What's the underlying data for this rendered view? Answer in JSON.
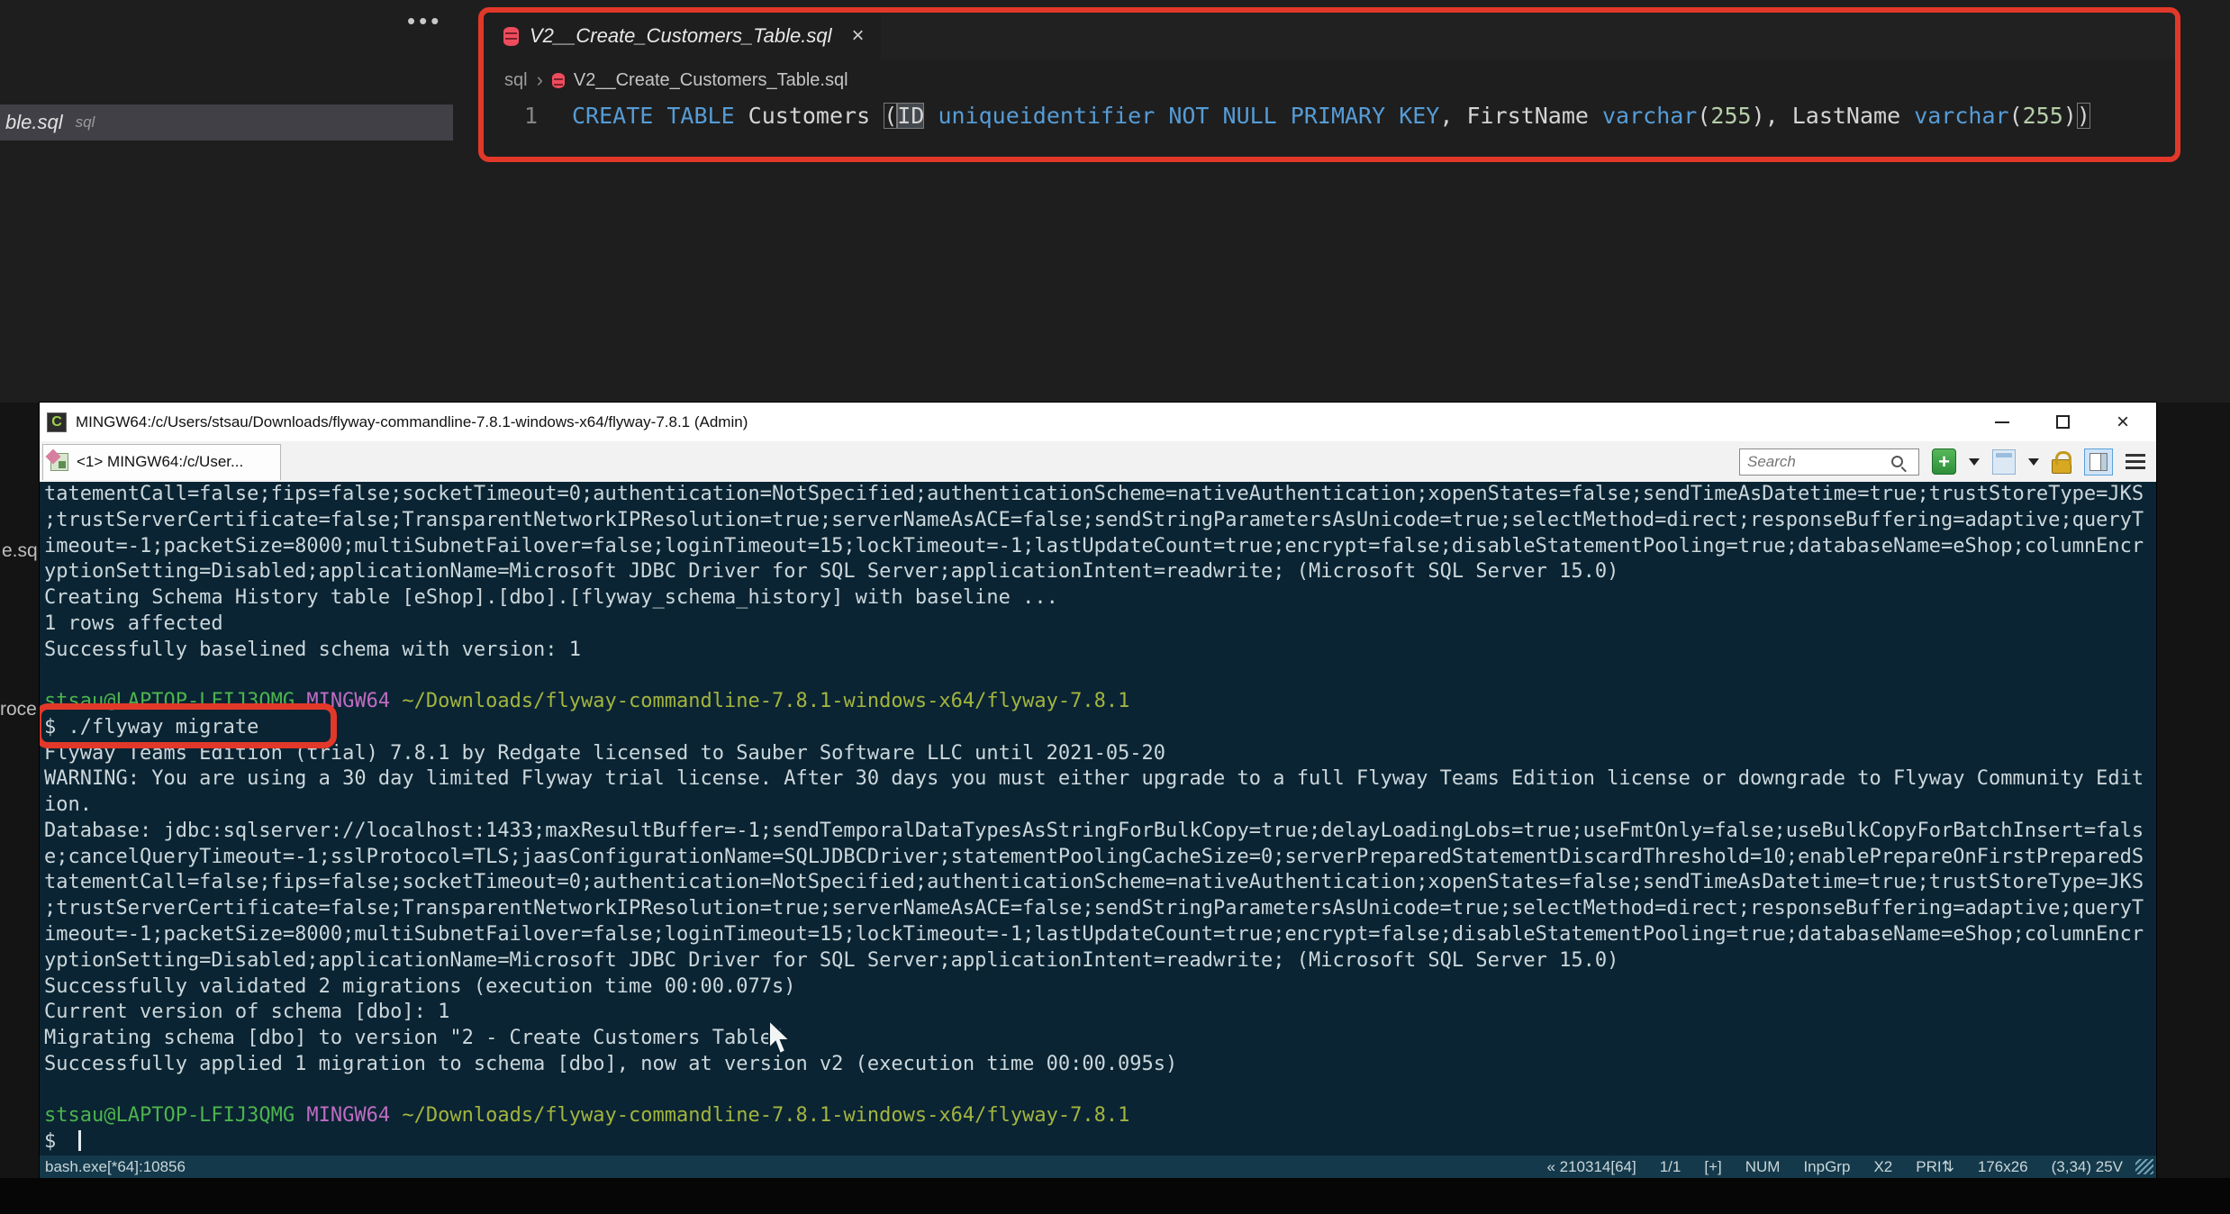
{
  "colors": {
    "annotation_red": "#e2382a",
    "terminal_bg": "#0a2433",
    "keyword_blue": "#569cd6",
    "number_green": "#b5cea8",
    "prompt_user_green": "#4db34d",
    "prompt_env_purple": "#bf6cc3",
    "prompt_path_olive": "#a3b43e"
  },
  "editor": {
    "more_actions_icon": "•••",
    "background_tab": {
      "filename": "ble.sql",
      "hint": "sql"
    },
    "fragments": {
      "one": "e.sq",
      "two": "roce"
    },
    "tab": {
      "filename": "V2__Create_Customers_Table.sql",
      "close_icon": "×"
    },
    "breadcrumb": {
      "folder": "sql",
      "separator": "›",
      "filename": "V2__Create_Customers_Table.sql"
    },
    "code": {
      "line_number": "1",
      "tokens": [
        {
          "text": "CREATE TABLE",
          "c": "kw"
        },
        {
          "text": " Customers ",
          "c": "pl"
        },
        {
          "text": "(",
          "c": "pl bracket"
        },
        {
          "text": "ID",
          "c": "pl word"
        },
        {
          "text": " ",
          "c": "pl"
        },
        {
          "text": "uniqueidentifier",
          "c": "kw"
        },
        {
          "text": " ",
          "c": "pl"
        },
        {
          "text": "NOT NULL PRIMARY KEY",
          "c": "kw"
        },
        {
          "text": ", FirstName ",
          "c": "pl"
        },
        {
          "text": "varchar",
          "c": "kw"
        },
        {
          "text": "(",
          "c": "pl"
        },
        {
          "text": "255",
          "c": "num"
        },
        {
          "text": ")",
          "c": "pl"
        },
        {
          "text": ", LastName ",
          "c": "pl"
        },
        {
          "text": "varchar",
          "c": "kw"
        },
        {
          "text": "(",
          "c": "pl"
        },
        {
          "text": "255",
          "c": "num"
        },
        {
          "text": ")",
          "c": "pl"
        },
        {
          "text": ")",
          "c": "pl bracket"
        }
      ]
    }
  },
  "terminal": {
    "title": "MINGW64:/c/Users/stsau/Downloads/flyway-commandline-7.8.1-windows-x64/flyway-7.8.1 (Admin)",
    "window_icon_letter": "C",
    "window_controls": {
      "close_icon": "×"
    },
    "tab_label": "<1> MINGW64:/c/User...",
    "search_placeholder": "Search",
    "new_console_label": "+",
    "prompt": {
      "user": "stsau@LAPTOP-LFIJ3QMG",
      "env": "MINGW64",
      "path": "~/Downloads/flyway-commandline-7.8.1-windows-x64/flyway-7.8.1"
    },
    "command": "$ ./flyway migrate",
    "input_prefix": "$ ",
    "lines": [
      {
        "t": "out",
        "text": "tatementCall=false;fips=false;socketTimeout=0;authentication=NotSpecified;authenticationScheme=nativeAuthentication;xopenStates=false;sendTimeAsDatetime=true;trustStoreType=JKS"
      },
      {
        "t": "out",
        "text": ";trustServerCertificate=false;TransparentNetworkIPResolution=true;serverNameAsACE=false;sendStringParametersAsUnicode=true;selectMethod=direct;responseBuffering=adaptive;queryT"
      },
      {
        "t": "out",
        "text": "imeout=-1;packetSize=8000;multiSubnetFailover=false;loginTimeout=15;lockTimeout=-1;lastUpdateCount=true;encrypt=false;disableStatementPooling=true;databaseName=eShop;columnEncr"
      },
      {
        "t": "out",
        "text": "yptionSetting=Disabled;applicationName=Microsoft JDBC Driver for SQL Server;applicationIntent=readwrite; (Microsoft SQL Server 15.0)"
      },
      {
        "t": "out",
        "text": "Creating Schema History table [eShop].[dbo].[flyway_schema_history] with baseline ..."
      },
      {
        "t": "out",
        "text": "1 rows affected"
      },
      {
        "t": "out",
        "text": "Successfully baselined schema with version: 1"
      },
      {
        "t": "blank"
      },
      {
        "t": "prompt"
      },
      {
        "t": "cmd"
      },
      {
        "t": "out",
        "text": "Flyway Teams Edition (trial) 7.8.1 by Redgate licensed to Sauber Software LLC until 2021-05-20"
      },
      {
        "t": "out",
        "text": "WARNING: You are using a 30 day limited Flyway trial license. After 30 days you must either upgrade to a full Flyway Teams Edition license or downgrade to Flyway Community Edit"
      },
      {
        "t": "out",
        "text": "ion."
      },
      {
        "t": "out",
        "text": "Database: jdbc:sqlserver://localhost:1433;maxResultBuffer=-1;sendTemporalDataTypesAsStringForBulkCopy=true;delayLoadingLobs=true;useFmtOnly=false;useBulkCopyForBatchInsert=fals"
      },
      {
        "t": "out",
        "text": "e;cancelQueryTimeout=-1;sslProtocol=TLS;jaasConfigurationName=SQLJDBCDriver;statementPoolingCacheSize=0;serverPreparedStatementDiscardThreshold=10;enablePrepareOnFirstPreparedS"
      },
      {
        "t": "out",
        "text": "tatementCall=false;fips=false;socketTimeout=0;authentication=NotSpecified;authenticationScheme=nativeAuthentication;xopenStates=false;sendTimeAsDatetime=true;trustStoreType=JKS"
      },
      {
        "t": "out",
        "text": ";trustServerCertificate=false;TransparentNetworkIPResolution=true;serverNameAsACE=false;sendStringParametersAsUnicode=true;selectMethod=direct;responseBuffering=adaptive;queryT"
      },
      {
        "t": "out",
        "text": "imeout=-1;packetSize=8000;multiSubnetFailover=false;loginTimeout=15;lockTimeout=-1;lastUpdateCount=true;encrypt=false;disableStatementPooling=true;databaseName=eShop;columnEncr"
      },
      {
        "t": "out",
        "text": "yptionSetting=Disabled;applicationName=Microsoft JDBC Driver for SQL Server;applicationIntent=readwrite; (Microsoft SQL Server 15.0)"
      },
      {
        "t": "out",
        "text": "Successfully validated 2 migrations (execution time 00:00.077s)"
      },
      {
        "t": "out",
        "text": "Current version of schema [dbo]: 1"
      },
      {
        "t": "out",
        "text": "Migrating schema [dbo] to version \"2 - Create Customers Table\""
      },
      {
        "t": "out",
        "text": "Successfully applied 1 migration to schema [dbo], now at version v2 (execution time 00:00.095s)"
      },
      {
        "t": "blank"
      },
      {
        "t": "prompt"
      },
      {
        "t": "input"
      }
    ],
    "status": {
      "left": "bash.exe[*64]:10856",
      "items": [
        "« 210314[64]",
        "1/1",
        "[+]",
        "NUM",
        "InpGrp",
        "X2",
        "PRI⇅",
        "176x26",
        "(3,34) 25V"
      ]
    }
  }
}
